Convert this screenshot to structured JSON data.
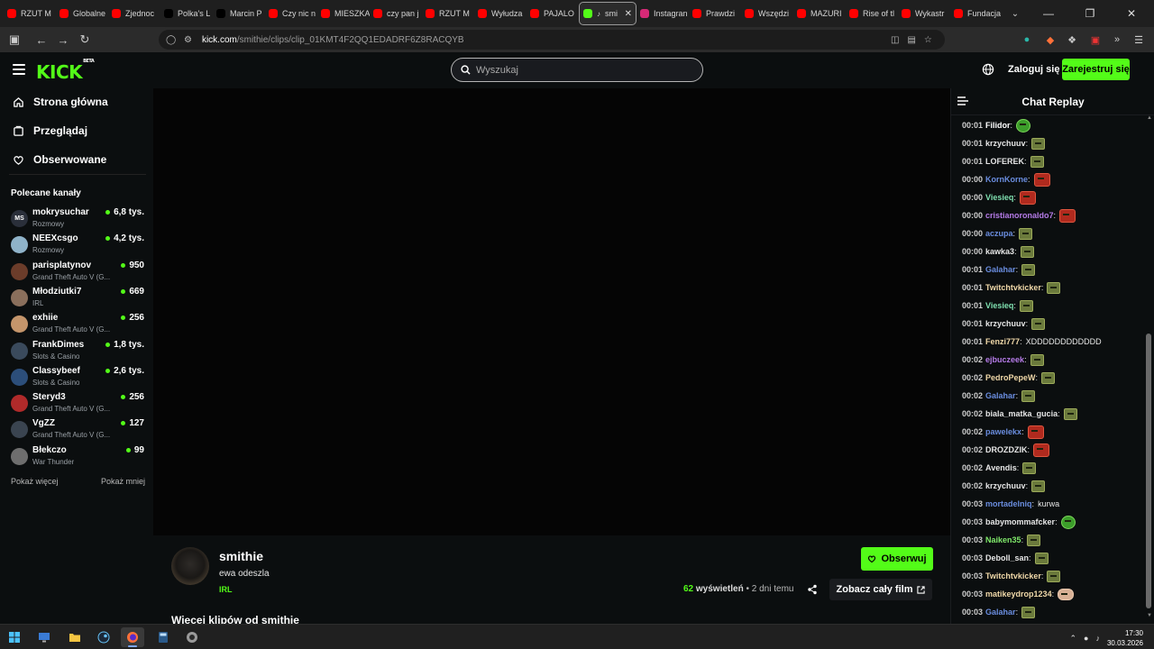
{
  "browser": {
    "tabs": [
      {
        "label": "RZUT M",
        "color": "#ff0000",
        "icon": "youtube-icon"
      },
      {
        "label": "Globalne",
        "color": "#ff0000",
        "icon": "youtube-icon"
      },
      {
        "label": "Zjednoc",
        "color": "#ff0000",
        "icon": "youtube-icon"
      },
      {
        "label": "Polka's L",
        "color": "#000000",
        "icon": "tiktok-icon"
      },
      {
        "label": "Marcin P",
        "color": "#000000",
        "icon": "x-icon"
      },
      {
        "label": "Czy nic n",
        "color": "#ff0000",
        "icon": "youtube-icon"
      },
      {
        "label": "MIESZKA",
        "color": "#ff0000",
        "icon": "youtube-icon"
      },
      {
        "label": "czy pan j",
        "color": "#ff0000",
        "icon": "youtube-icon"
      },
      {
        "label": "RZUT M",
        "color": "#ff0000",
        "icon": "youtube-icon"
      },
      {
        "label": "Wyłudza",
        "color": "#ff0000",
        "icon": "youtube-icon"
      },
      {
        "label": "PAJALO",
        "color": "#ff0000",
        "icon": "youtube-icon"
      },
      {
        "label": "smi",
        "color": "#53fc18",
        "icon": "kick-icon",
        "active": true
      },
      {
        "label": "Instagran",
        "color": "#d62976",
        "icon": "instagram-icon"
      },
      {
        "label": "Prawdzi",
        "color": "#ff0000",
        "icon": "youtube-icon"
      },
      {
        "label": "Wszędzi",
        "color": "#ff0000",
        "icon": "youtube-icon"
      },
      {
        "label": "MAZURI",
        "color": "#ff0000",
        "icon": "youtube-icon"
      },
      {
        "label": "Rise of tl",
        "color": "#ff0000",
        "icon": "youtube-icon"
      },
      {
        "label": "Wykastr",
        "color": "#ff0000",
        "icon": "youtube-icon"
      },
      {
        "label": "Fundacja",
        "color": "#ff0000",
        "icon": "youtube-icon"
      }
    ],
    "url_host": "kick.com",
    "url_path": "/smithie/clips/clip_01KMT4F2QQ1EDADRF6Z8RACQYB",
    "ext_badge": "8"
  },
  "header": {
    "logo": "KICK",
    "logo_badge": "BETA",
    "search_placeholder": "Wyszukaj",
    "login": "Zaloguj się",
    "register": "Zarejestruj się"
  },
  "sidebar": {
    "nav": [
      {
        "label": "Strona główna",
        "icon": "home-icon"
      },
      {
        "label": "Przeglądaj",
        "icon": "browse-icon"
      },
      {
        "label": "Obserwowane",
        "icon": "heart-icon"
      }
    ],
    "recommended_title": "Polecane kanały",
    "channels": [
      {
        "name": "mokrysuchar",
        "category": "Rozmowy",
        "viewers": "6,8 tys.",
        "color": "#2a2f3a",
        "initials": "MS"
      },
      {
        "name": "NEEXcsgo",
        "category": "Rozmowy",
        "viewers": "4,2 tys.",
        "color": "#8fb3c9",
        "initials": ""
      },
      {
        "name": "parisplatynov",
        "category": "Grand Theft Auto V (G...",
        "viewers": "950",
        "color": "#6b3c2a",
        "initials": ""
      },
      {
        "name": "Młodziutki7",
        "category": "IRL",
        "viewers": "669",
        "color": "#8a6f5c",
        "initials": ""
      },
      {
        "name": "exhiie",
        "category": "Grand Theft Auto V (G...",
        "viewers": "256",
        "color": "#c4956b",
        "initials": ""
      },
      {
        "name": "FrankDimes",
        "category": "Slots & Casino",
        "viewers": "1,8 tys.",
        "color": "#3a4a5c",
        "initials": ""
      },
      {
        "name": "Classybeef",
        "category": "Slots & Casino",
        "viewers": "2,6 tys.",
        "color": "#2c4e7a",
        "initials": ""
      },
      {
        "name": "Steryd3",
        "category": "Grand Theft Auto V (G...",
        "viewers": "256",
        "color": "#b02a2a",
        "initials": ""
      },
      {
        "name": "VgZZ",
        "category": "Grand Theft Auto V (G...",
        "viewers": "127",
        "color": "#3a4450",
        "initials": ""
      },
      {
        "name": "Błekczo",
        "category": "War Thunder",
        "viewers": "99",
        "color": "#6e6e6e",
        "initials": ""
      }
    ],
    "show_more": "Pokaż więcej",
    "show_less": "Pokaż mniej"
  },
  "clip": {
    "channel": "smithie",
    "title": "ewa odeszla",
    "category": "IRL",
    "follow": "Obserwuj",
    "views_count": "62",
    "views_label": "wyświetleń",
    "age": "2 dni temu",
    "full_film": "Zobacz cały film",
    "more_clips": "Więcej klipów od smithie"
  },
  "chat": {
    "title": "Chat Replay",
    "messages": [
      {
        "time": "00:01",
        "user": "Filidor",
        "color": "#ffffff",
        "text": "",
        "emote": "green"
      },
      {
        "time": "00:01",
        "user": "krzychuuv",
        "color": "#e6e6e6",
        "text": "",
        "emote": "plain"
      },
      {
        "time": "00:01",
        "user": "LOFEREK",
        "color": "#e6e6e6",
        "text": "",
        "emote": "plain"
      },
      {
        "time": "00:00",
        "user": "KornKorne",
        "color": "#6a8ddf",
        "text": "",
        "emote": "red"
      },
      {
        "time": "00:00",
        "user": "Viesieq",
        "color": "#7fe0b0",
        "text": "",
        "emote": "red"
      },
      {
        "time": "00:00",
        "user": "cristianoronaldo7",
        "color": "#b57be8",
        "text": "",
        "emote": "red"
      },
      {
        "time": "00:00",
        "user": "aczupa",
        "color": "#6a8ddf",
        "text": "",
        "emote": "plain"
      },
      {
        "time": "00:00",
        "user": "kawka3",
        "color": "#e6e6e6",
        "text": "",
        "emote": "plain"
      },
      {
        "time": "00:01",
        "user": "Galahar",
        "color": "#6a8ddf",
        "text": "",
        "emote": "plain"
      },
      {
        "time": "00:01",
        "user": "Twitchtvkicker",
        "color": "#f0d8a8",
        "text": "",
        "emote": "plain"
      },
      {
        "time": "00:01",
        "user": "Viesieq",
        "color": "#7fe0b0",
        "text": "",
        "emote": "plain"
      },
      {
        "time": "00:01",
        "user": "krzychuuv",
        "color": "#e6e6e6",
        "text": "",
        "emote": "plain"
      },
      {
        "time": "00:01",
        "user": "Fenzi777",
        "color": "#f0d8a8",
        "text": "XDDDDDDDDDDDD",
        "emote": ""
      },
      {
        "time": "00:02",
        "user": "ejbuczeek",
        "color": "#b57be8",
        "text": "",
        "emote": "plain"
      },
      {
        "time": "00:02",
        "user": "PedroPepeW",
        "color": "#f0d8a8",
        "text": "",
        "emote": "plain"
      },
      {
        "time": "00:02",
        "user": "Galahar",
        "color": "#6a8ddf",
        "text": "",
        "emote": "plain"
      },
      {
        "time": "00:02",
        "user": "biala_matka_gucia",
        "color": "#e6e6e6",
        "text": "",
        "emote": "plain"
      },
      {
        "time": "00:02",
        "user": "pawelekx",
        "color": "#6a8ddf",
        "text": "",
        "emote": "red"
      },
      {
        "time": "00:02",
        "user": "DROZDZIK",
        "color": "#e6e6e6",
        "text": "",
        "emote": "red"
      },
      {
        "time": "00:02",
        "user": "Avendis",
        "color": "#e6e6e6",
        "text": "",
        "emote": "plain"
      },
      {
        "time": "00:02",
        "user": "krzychuuv",
        "color": "#e6e6e6",
        "text": "",
        "emote": "plain"
      },
      {
        "time": "00:03",
        "user": "mortadelniq",
        "color": "#6a8ddf",
        "text": "kurwa",
        "emote": ""
      },
      {
        "time": "00:03",
        "user": "babymommafcker",
        "color": "#e6e6e6",
        "text": "",
        "emote": "green"
      },
      {
        "time": "00:03",
        "user": "Naiken35",
        "color": "#7fe86a",
        "text": "",
        "emote": "plain"
      },
      {
        "time": "00:03",
        "user": "Deboll_san",
        "color": "#e6e6e6",
        "text": "",
        "emote": "plain"
      },
      {
        "time": "00:03",
        "user": "Twitchtvkicker",
        "color": "#f0d8a8",
        "text": "",
        "emote": "plain"
      },
      {
        "time": "00:03",
        "user": "matikeydrop1234",
        "color": "#f0d8a8",
        "text": "",
        "emote": "hand"
      },
      {
        "time": "00:03",
        "user": "Galahar",
        "color": "#6a8ddf",
        "text": "",
        "emote": "plain"
      }
    ]
  },
  "taskbar": {
    "time": "17:30",
    "date": "30.03.2026"
  }
}
